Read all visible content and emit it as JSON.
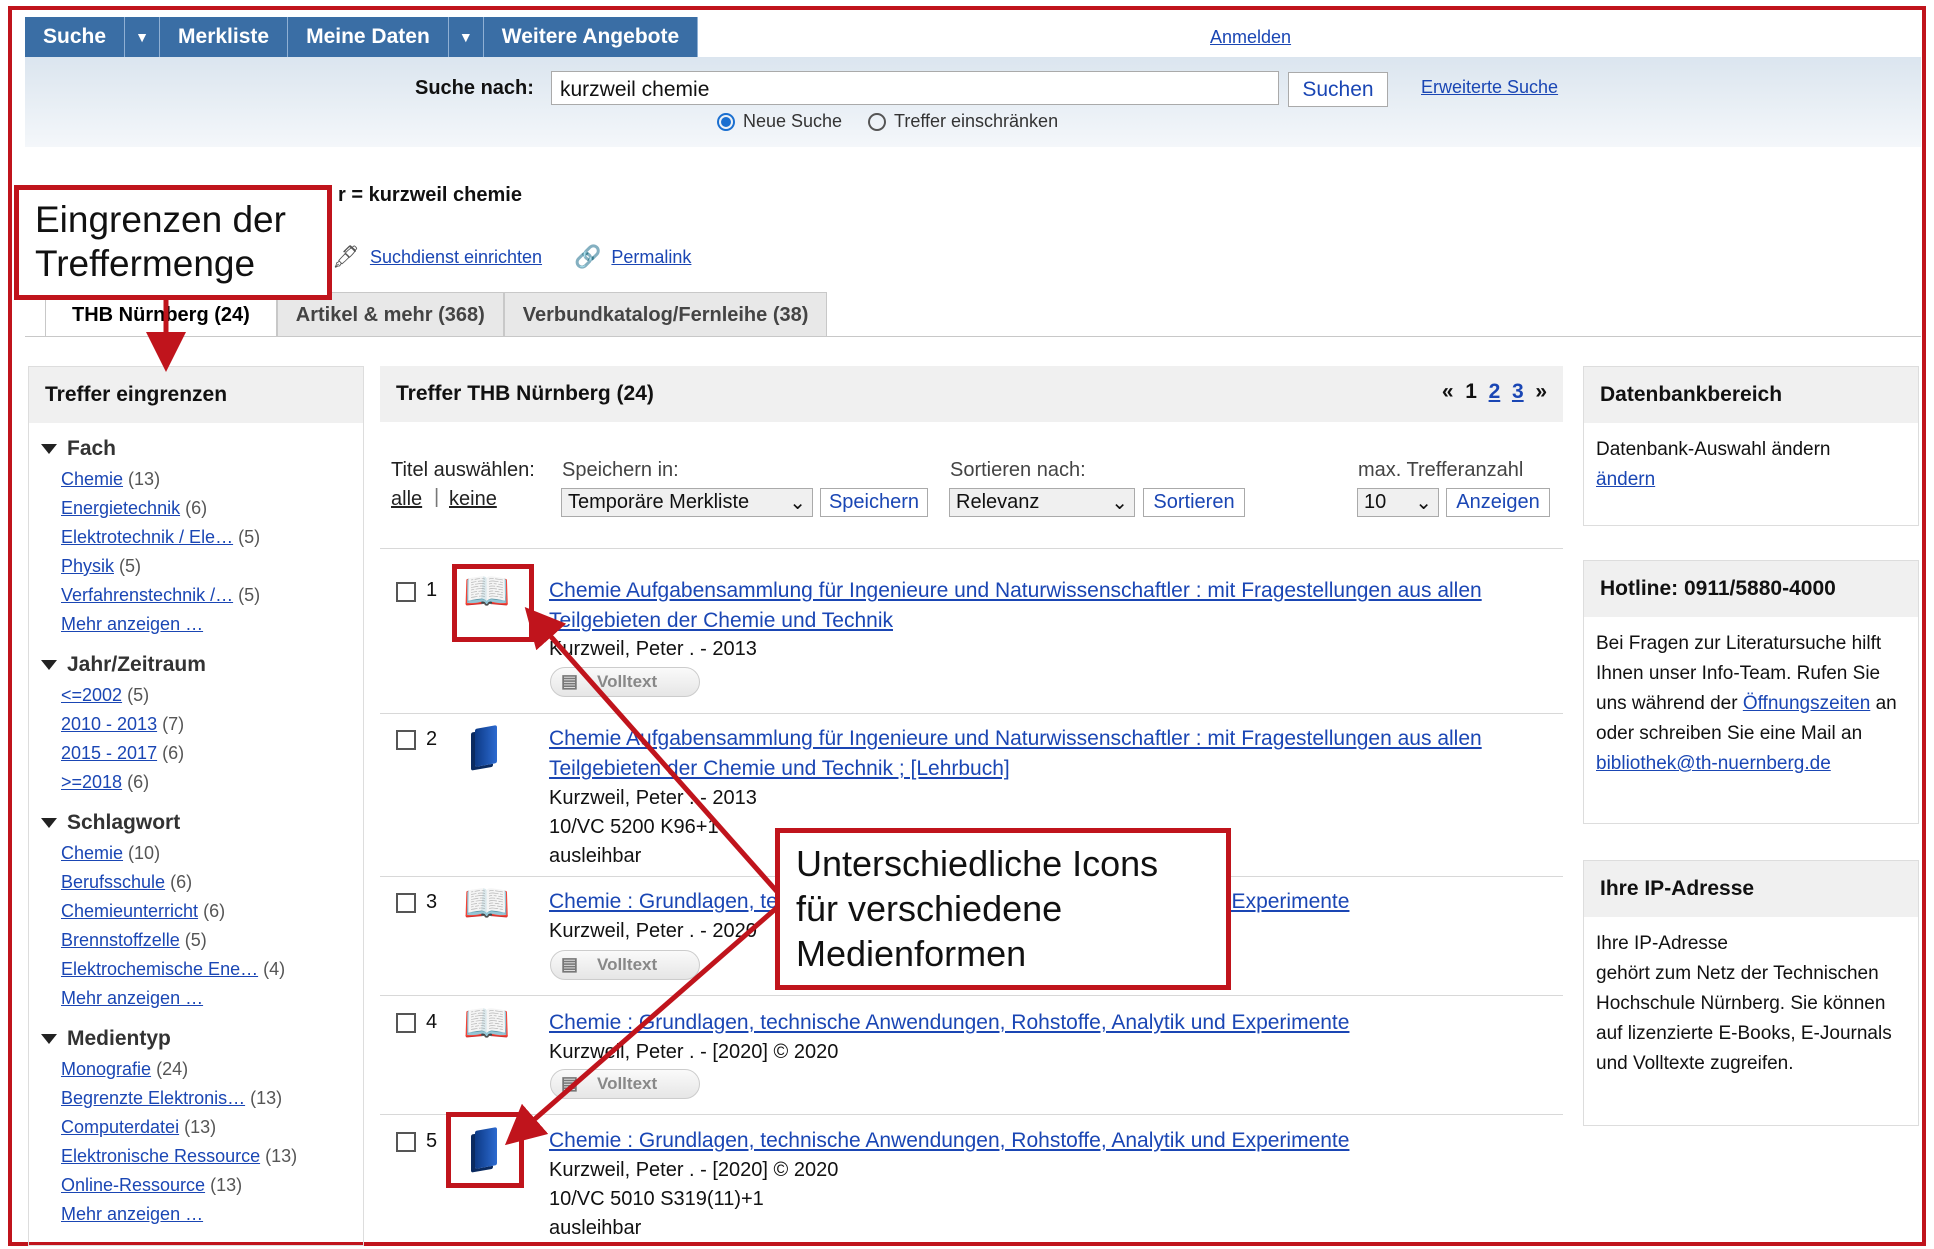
{
  "nav": {
    "items": [
      "Suche",
      "Merkliste",
      "Meine Daten",
      "Weitere Angebote"
    ],
    "login": "Anmelden"
  },
  "search": {
    "label": "Suche nach:",
    "value": "kurzweil chemie",
    "button": "Suchen",
    "advanced": "Erweiterte Suche",
    "radio_new": "Neue Suche",
    "radio_narrow": "Treffer einschränken"
  },
  "query_line": "r = kurzweil chemie",
  "tools": {
    "alert": "Suchdienst einrichten",
    "permalink": "Permalink"
  },
  "tabs": [
    "THB Nürnberg (24)",
    "Artikel & mehr (368)",
    "Verbundkatalog/Fernleihe (38)"
  ],
  "facets": {
    "title": "Treffer eingrenzen",
    "groups": [
      {
        "name": "Fach",
        "items": [
          [
            "Chemie",
            "(13)"
          ],
          [
            "Energietechnik",
            "(6)"
          ],
          [
            "Elektrotechnik / Ele…",
            "(5)"
          ],
          [
            "Physik",
            "(5)"
          ],
          [
            "Verfahrenstechnik /…",
            "(5)"
          ],
          [
            "Mehr anzeigen …",
            ""
          ]
        ]
      },
      {
        "name": "Jahr/Zeitraum",
        "items": [
          [
            "<=2002",
            "(5)"
          ],
          [
            "2010 - 2013",
            "(7)"
          ],
          [
            "2015 - 2017",
            "(6)"
          ],
          [
            ">=2018",
            "(6)"
          ]
        ]
      },
      {
        "name": "Schlagwort",
        "items": [
          [
            "Chemie",
            "(10)"
          ],
          [
            "Berufsschule",
            "(6)"
          ],
          [
            "Chemieunterricht",
            "(6)"
          ],
          [
            "Brennstoffzelle",
            "(5)"
          ],
          [
            "Elektrochemische Ene…",
            "(4)"
          ],
          [
            "Mehr anzeigen …",
            ""
          ]
        ]
      },
      {
        "name": "Medientyp",
        "items": [
          [
            "Monografie",
            "(24)"
          ],
          [
            "Begrenzte Elektronis…",
            "(13)"
          ],
          [
            "Computerdatei",
            "(13)"
          ],
          [
            "Elektronische Ressource",
            "(13)"
          ],
          [
            "Online-Ressource",
            "(13)"
          ],
          [
            "Mehr anzeigen …",
            ""
          ]
        ]
      }
    ]
  },
  "results": {
    "header": "Treffer THB Nürnberg (24)",
    "pager": {
      "prev": "«",
      "current": "1",
      "pages": [
        "2",
        "3"
      ],
      "next": "»"
    },
    "select_label": "Titel auswählen:",
    "select_all": "alle",
    "select_none": "keine",
    "save_label": "Speichern in:",
    "save_value": "Temporäre Merkliste",
    "save_button": "Speichern",
    "sort_label": "Sortieren nach:",
    "sort_value": "Relevanz",
    "sort_button": "Sortieren",
    "max_label": "max. Trefferanzahl",
    "max_value": "10",
    "max_button": "Anzeigen",
    "fulltext": "Volltext",
    "hits": [
      {
        "n": "1",
        "media": "ebook",
        "title1": "Chemie Aufgabensammlung für Ingenieure und Naturwissenschaftler : mit Fragestellungen aus allen",
        "title2": "Teilgebieten der Chemie und Technik",
        "meta": [
          "Kurzweil, Peter . - 2013"
        ]
      },
      {
        "n": "2",
        "media": "book",
        "title1": "Chemie Aufgabensammlung für Ingenieure und Naturwissenschaftler : mit Fragestellungen aus allen",
        "title2": "Teilgebieten der Chemie und Technik ; [Lehrbuch]",
        "meta": [
          "Kurzweil, Peter . - 2013",
          "10/VC 5200 K96+1",
          "ausleihbar"
        ]
      },
      {
        "n": "3",
        "media": "ebook",
        "title1": "Chemie : Grundlagen, technische Anwendungen, Rohstoffe, Analytik und Experimente",
        "title2": "",
        "meta": [
          "Kurzweil, Peter . - 2020"
        ]
      },
      {
        "n": "4",
        "media": "ebook",
        "title1": "Chemie : Grundlagen, technische Anwendungen, Rohstoffe, Analytik und Experimente",
        "title2": "",
        "meta": [
          "Kurzweil, Peter . - [2020] © 2020"
        ]
      },
      {
        "n": "5",
        "media": "book",
        "title1": "Chemie : Grundlagen, technische Anwendungen, Rohstoffe, Analytik und Experimente",
        "title2": "",
        "meta": [
          "Kurzweil, Peter . - [2020] © 2020",
          "10/VC 5010 S319(11)+1",
          "ausleihbar"
        ]
      }
    ]
  },
  "right": {
    "db_title": "Datenbankbereich",
    "db_text": "Datenbank-Auswahl ändern",
    "db_link": "ändern",
    "hotline_title": "Hotline: 0911/5880-4000",
    "hotline_text1": "Bei Fragen zur Literatursuche hilft Ihnen unser Info-Team. Rufen Sie uns während der",
    "hotline_link1": "Öffnungszeiten",
    "hotline_text2": "an oder schreiben Sie eine Mail an",
    "hotline_link2": "bibliothek@th-nuernberg.de",
    "ip_title": "Ihre IP-Adresse",
    "ip_text1": "Ihre IP-Adresse",
    "ip_text2": "gehört zum Netz der Technischen Hochschule Nürnberg. Sie können auf lizenzierte E-Books, E-Journals und Volltexte zugreifen."
  },
  "annotations": {
    "left": "Eingrenzen der Treffermenge",
    "center": "Unterschiedliche Icons für verschiedene Medienformen",
    "color": "#c0141c"
  }
}
